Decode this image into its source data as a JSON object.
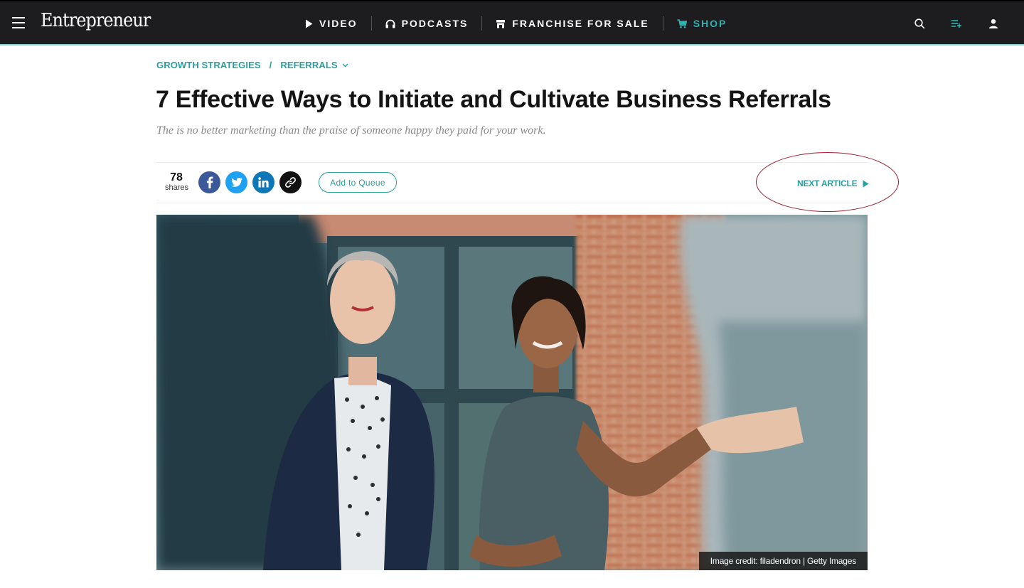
{
  "header": {
    "logo": "Entrepreneur",
    "nav": [
      {
        "label": "VIDEO",
        "icon": "play-icon"
      },
      {
        "label": "PODCASTS",
        "icon": "headphones-icon"
      },
      {
        "label": "FRANCHISE FOR SALE",
        "icon": "storefront-icon"
      },
      {
        "label": "SHOP",
        "icon": "cart-icon",
        "color": "#2fb3b0"
      }
    ],
    "right_icons": [
      "search-icon",
      "queue-add-icon",
      "user-icon"
    ],
    "accent": "#7fd6d0"
  },
  "breadcrumb": {
    "items": [
      "GROWTH STRATEGIES",
      "REFERRALS"
    ],
    "separator": "/"
  },
  "article": {
    "title": "7 Effective Ways to Initiate and Cultivate Business Referrals",
    "subtitle": "The is no better marketing than the praise of someone happy they paid for your work."
  },
  "share": {
    "count": "78",
    "count_label": "shares",
    "networks": [
      "facebook-icon",
      "twitter-icon",
      "linkedin-icon",
      "link-icon"
    ],
    "queue_label": "Add to Queue",
    "next_label": "NEXT ARTICLE"
  },
  "hero": {
    "credit": "Image credit: filadendron | Getty Images"
  },
  "colors": {
    "teal": "#2a9fa0",
    "dark_bar": "#1d1d1f",
    "annotation_ring": "#9b1c2e"
  }
}
